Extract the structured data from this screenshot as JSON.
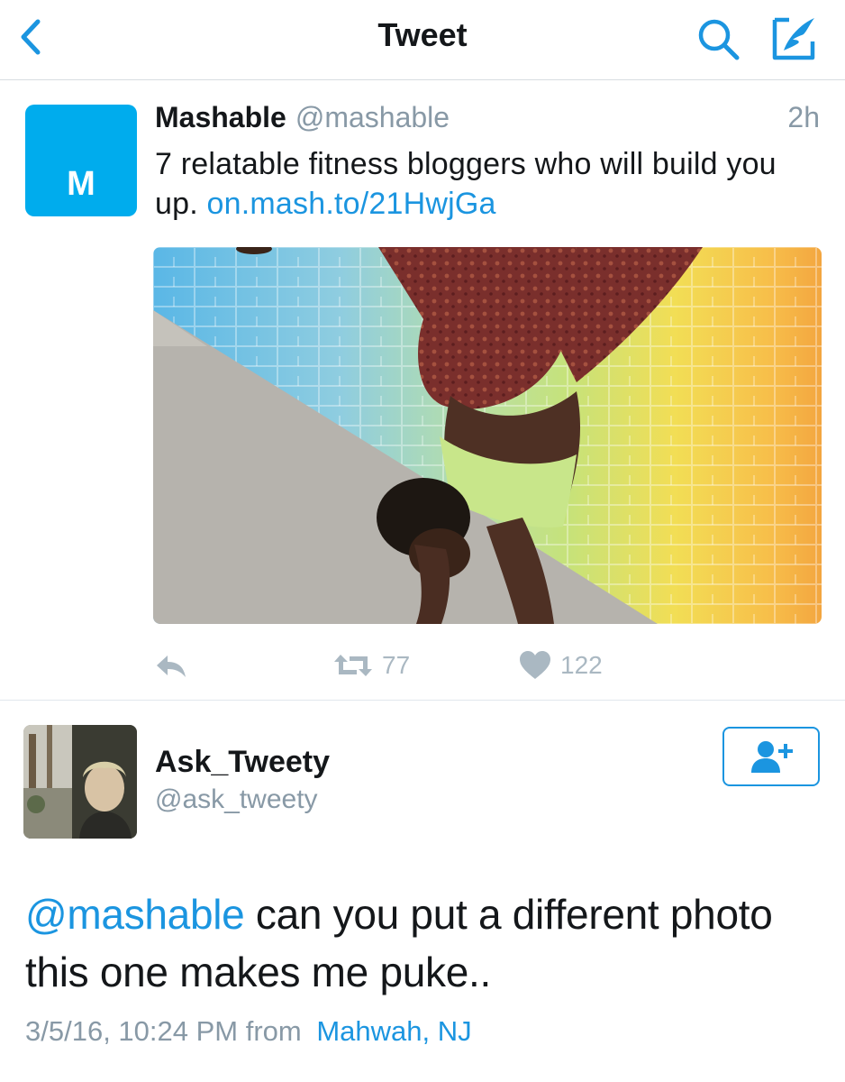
{
  "colors": {
    "accent": "#1b95e0",
    "mashable_blue": "#00aced",
    "muted": "#8899a6"
  },
  "navbar": {
    "title": "Tweet",
    "back_icon": "chevron-left-icon",
    "search_icon": "search-icon",
    "compose_icon": "compose-icon"
  },
  "quoted_tweet": {
    "avatar_letter": "M",
    "name": "Mashable",
    "handle": "@mashable",
    "time": "2h",
    "text": "7 relatable fitness bloggers who will build you up.",
    "link": "on.mash.to/21HwjGa",
    "actions": {
      "retweets": "77",
      "likes": "122"
    }
  },
  "tweet": {
    "name": "Ask_Tweety",
    "handle": "@ask_tweety",
    "mention": "@mashable",
    "text": " can you put a different photo this one makes me puke..",
    "timestamp": "3/5/16, 10:24 PM from",
    "location": "Mahwah, NJ"
  }
}
